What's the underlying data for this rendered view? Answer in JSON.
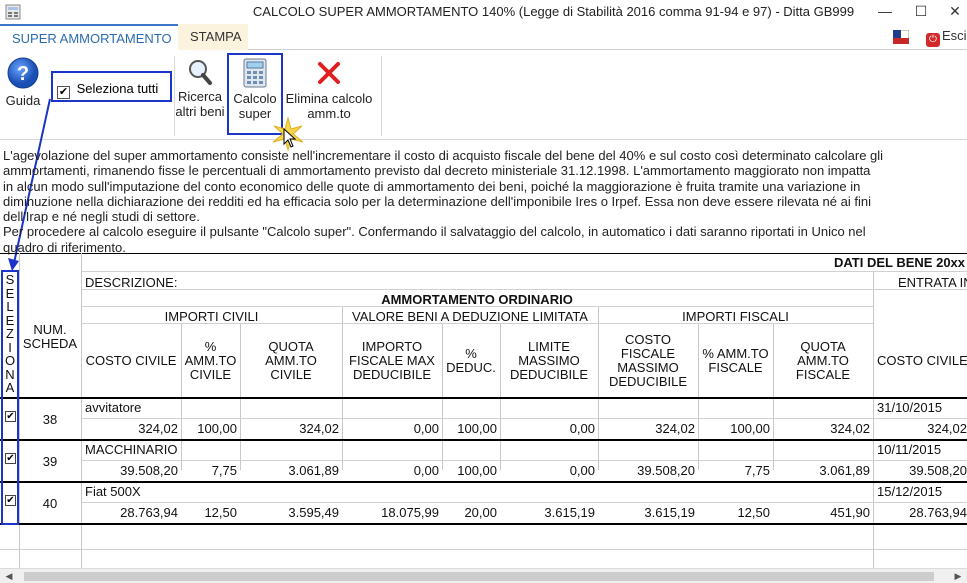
{
  "window": {
    "title": "CALCOLO SUPER AMMORTAMENTO 140% (Legge di Stabilità 2016 comma 91-94 e 97) - Ditta GB999",
    "minimize": "—",
    "maximize": "☐",
    "close": "✕"
  },
  "tabs": [
    {
      "label": "SUPER AMMORTAMENTO"
    },
    {
      "label": "STAMPA"
    }
  ],
  "exit_label": "Esci",
  "toolbar": {
    "guida": "Guida",
    "seleziona_tutti": "Seleziona tutti",
    "ricerca_1": "Ricerca",
    "ricerca_2": "altri beni",
    "calcolo_1": "Calcolo",
    "calcolo_2": "super",
    "elimina_1": "Elimina calcolo",
    "elimina_2": "amm.to"
  },
  "description": [
    "L'agevolazione del super ammortamento consiste nell'incrementare il costo di acquisto fiscale del bene del 40% e sul costo così determinato calcolare gli",
    "ammortamenti, rimanendo fisse le percentuali di ammortamento previsto dal decreto ministeriale 31.12.1998. L'ammortamento maggiorato non impatta",
    "in alcun modo sull'imputazione del conto economico delle quote di ammortamento dei beni, poiché la maggiorazione è fruita tramite una variazione in",
    "diminuzione nella dichiarazione dei redditi ed ha efficacia solo per la determinazione dell'imponibile Ires o Irpef. Essa non deve essere rilevata né ai fini",
    "dell'Irap e né negli studi di settore.",
    "Per procedere al calcolo eseguire il pulsante \"Calcolo super\". Confermando il salvataggio del calcolo, in automatico i dati saranno riportati in Unico nel",
    "quadro di riferimento."
  ],
  "grid": {
    "seleziona_vertical": [
      "S",
      "E",
      "L",
      "E",
      "Z",
      "I",
      "O",
      "N",
      "A"
    ],
    "num_scheda": [
      "NUM.",
      "SCHEDA"
    ],
    "dati_bene": "DATI DEL BENE 20xx",
    "descrizione": "DESCRIZIONE:",
    "entrata": "ENTRATA IN",
    "ammortamento_ordinario": "AMMORTAMENTO ORDINARIO",
    "importi_civili": "IMPORTI CIVILI",
    "valore_beni": "VALORE BENI A DEDUZIONE LIMITATA",
    "importi_fiscali": "IMPORTI FISCALI",
    "cols": {
      "costo_civile": [
        "COSTO CIVILE"
      ],
      "perc_amm_civile": [
        "%",
        "AMM.TO",
        "CIVILE"
      ],
      "quota_amm_civile": [
        "QUOTA",
        "AMM.TO",
        "CIVILE"
      ],
      "importo_fiscale_max": [
        "IMPORTO",
        "FISCALE MAX",
        "DEDUCIBILE"
      ],
      "perc_deduc": [
        "%",
        "DEDUC."
      ],
      "limite_massimo": [
        "LIMITE",
        "MASSIMO",
        "DEDUCIBILE"
      ],
      "costo_fiscale": [
        "COSTO",
        "FISCALE",
        "MASSIMO",
        "DEDUCIBILE"
      ],
      "perc_amm_fiscale": [
        "% AMM.TO",
        "FISCALE"
      ],
      "quota_amm_fiscale": [
        "QUOTA",
        "AMM.TO",
        "FISCALE"
      ],
      "costo_civile_2": [
        "COSTO CIVILE"
      ]
    },
    "rows": [
      {
        "checked": "✔",
        "num": "38",
        "descrizione": "avvitatore",
        "entrata": "31/10/2015",
        "values": [
          "324,02",
          "100,00",
          "324,02",
          "0,00",
          "100,00",
          "0,00",
          "324,02",
          "100,00",
          "324,02",
          "324,02"
        ]
      },
      {
        "checked": "✔",
        "num": "39",
        "descrizione": "MACCHINARIO",
        "entrata": "10/11/2015",
        "values": [
          "39.508,20",
          "7,75",
          "3.061,89",
          "0,00",
          "100,00",
          "0,00",
          "39.508,20",
          "7,75",
          "3.061,89",
          "39.508,20"
        ]
      },
      {
        "checked": "✔",
        "num": "40",
        "descrizione": "Fiat 500X",
        "entrata": "15/12/2015",
        "values": [
          "28.763,94",
          "12,50",
          "3.595,49",
          "18.075,99",
          "20,00",
          "3.615,19",
          "3.615,19",
          "12,50",
          "451,90",
          "28.763,94"
        ]
      }
    ]
  },
  "colors": {
    "accent": "#2b6cb0",
    "highlight": "#1b34c9",
    "stampa_tab_bg": "#fbf3dd"
  }
}
